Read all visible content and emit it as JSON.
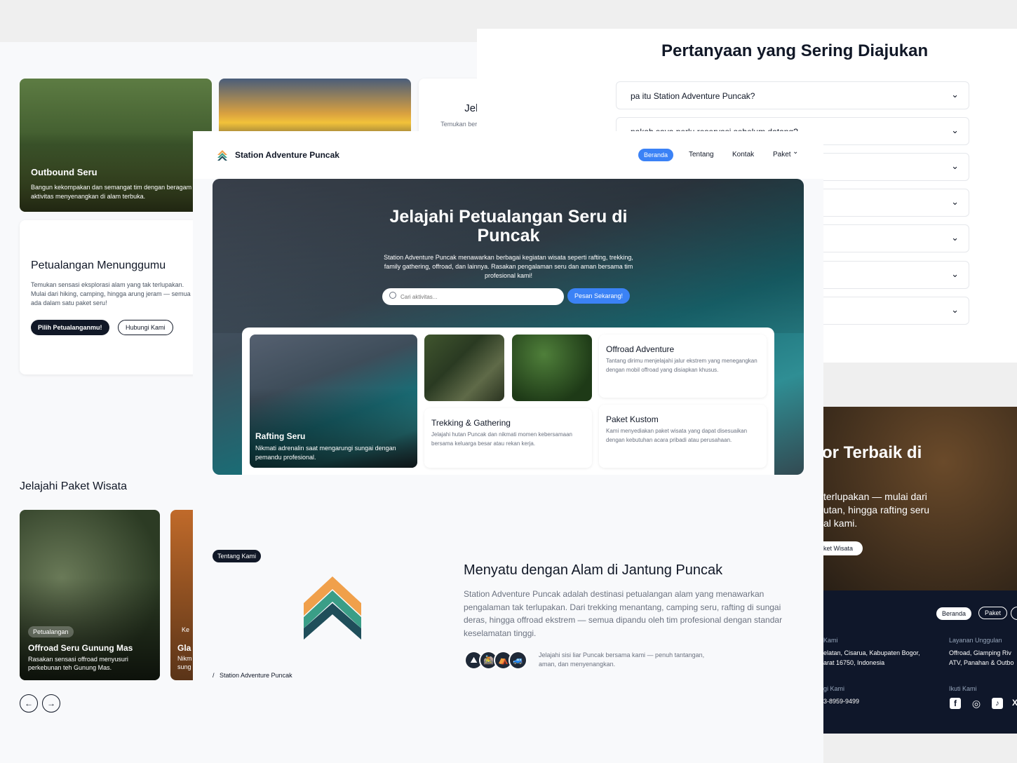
{
  "back_left": {
    "outbound": {
      "title": "Outbound Seru",
      "desc": "Bangun kekompakan dan semangat tim dengan beragam aktivitas menyenangkan di alam terbuka."
    },
    "jelajahi_card": {
      "title": "Jelajahi Paket Wisata",
      "desc": "Temukan berbagai pilihan paket wisata menarik yang"
    },
    "adventure": {
      "title": "Petualangan Menunggumu",
      "desc": "Temukan sensasi eksplorasi alam yang tak terlupakan. Mulai dari hiking, camping, hingga arung jeram — semua ada dalam satu paket seru!",
      "btn_primary": "Pilih Petualanganmu!",
      "btn_secondary": "Hubungi Kami"
    },
    "packages_heading": "Jelajahi Paket Wisata",
    "package_card": {
      "badge": "Petualangan",
      "title": "Offroad Seru Gunung Mas",
      "desc": "Rasakan sensasi offroad menyusuri perkebunan teh Gunung Mas."
    },
    "package_card2": {
      "badge": "Ke",
      "title": "Gla",
      "desc1": "Nikm",
      "desc2": "sung"
    },
    "prev_label": "←",
    "next_label": "→"
  },
  "back_right": {
    "faq_title": "Pertanyaan yang Sering Diajukan",
    "faq": [
      "pa itu Station Adventure Puncak?",
      "pakah saya perlu reservasi sebelum datang?",
      "",
      "",
      "",
      "",
      ""
    ],
    "chevron": "⌄",
    "cta": {
      "title": "or Terbaik di",
      "desc1": "terlupakan — mulai dari",
      "desc2": "utan, hingga rafting seru",
      "desc3": "al kami.",
      "btn": "ket Wisata"
    },
    "footer": {
      "nav": [
        "Beranda",
        "Paket",
        ""
      ],
      "col1_head": "Kami",
      "col1_l1": "elatan, Cisarua, Kabupaten Bogor,",
      "col1_l2": "arat 16750, Indonesia",
      "col2_head": "gi Kami",
      "phone": "3-8959-9499",
      "col3_head": "Layanan Unggulan",
      "col3_l1": "Offroad, Glamping Riv",
      "col3_l2": "ATV, Panahan & Outbo",
      "follow_head": "Ikuti Kami",
      "socials": [
        "f",
        "◎",
        "♪",
        "X"
      ]
    }
  },
  "main": {
    "brand": "Station Adventure Puncak",
    "nav": {
      "home": "Beranda",
      "about": "Tentang",
      "contact": "Kontak",
      "packages": "Paket",
      "caret": "⌄"
    },
    "hero": {
      "title": "Jelajahi Petualangan Seru di Puncak",
      "desc": "Station Adventure Puncak menawarkan berbagai kegiatan wisata seperti rafting, trekking, family gathering, offroad, dan lainnya. Rasakan pengalaman seru dan aman bersama tim profesional kami!",
      "search_placeholder": "Cari aktivitas...",
      "cta": "Pesan Sekarang!"
    },
    "activities": {
      "rafting": {
        "title": "Rafting Seru",
        "desc": "Nikmati adrenalin saat mengarungi sungai dengan pemandu profesional."
      },
      "trekking": {
        "title": "Trekking & Gathering",
        "desc": "Jelajahi hutan Puncak dan nikmati momen kebersamaan bersama keluarga besar atau rekan kerja."
      },
      "offroad": {
        "title": "Offroad Adventure",
        "desc": "Tantang dirimu menjelajahi jalur ekstrem yang menegangkan dengan mobil offroad yang disiapkan khusus."
      },
      "custom": {
        "title": "Paket Kustom",
        "desc": "Kami menyediakan paket wisata yang dapat disesuaikan dengan kebutuhan acara pribadi atau perusahaan."
      }
    },
    "about": {
      "badge": "Tentang Kami",
      "title": "Menyatu dengan Alam di Jantung Puncak",
      "desc": "Station Adventure Puncak adalah destinasi petualangan alam yang menawarkan pengalaman tak terlupakan. Dari trekking menantang, camping seru, rafting di sungai deras, hingga offroad ekstrem — semua dipandu oleh tim profesional dengan standar keselamatan tinggi.",
      "note": "Jelajahi sisi liar Puncak bersama kami — penuh tantangan, aman, dan menyenangkan.",
      "breadcrumb_sep": "/",
      "breadcrumb": "Station Adventure Puncak",
      "activity_icons": [
        "⛰",
        "🚵",
        "⛺",
        "🚙"
      ]
    }
  },
  "colors": {
    "dark": "#111827",
    "accent": "#3b82f6",
    "footer": "#0f172a",
    "logo_orange": "#f0a04b",
    "logo_green": "#3a9e87",
    "logo_teal": "#1f4e5a"
  }
}
